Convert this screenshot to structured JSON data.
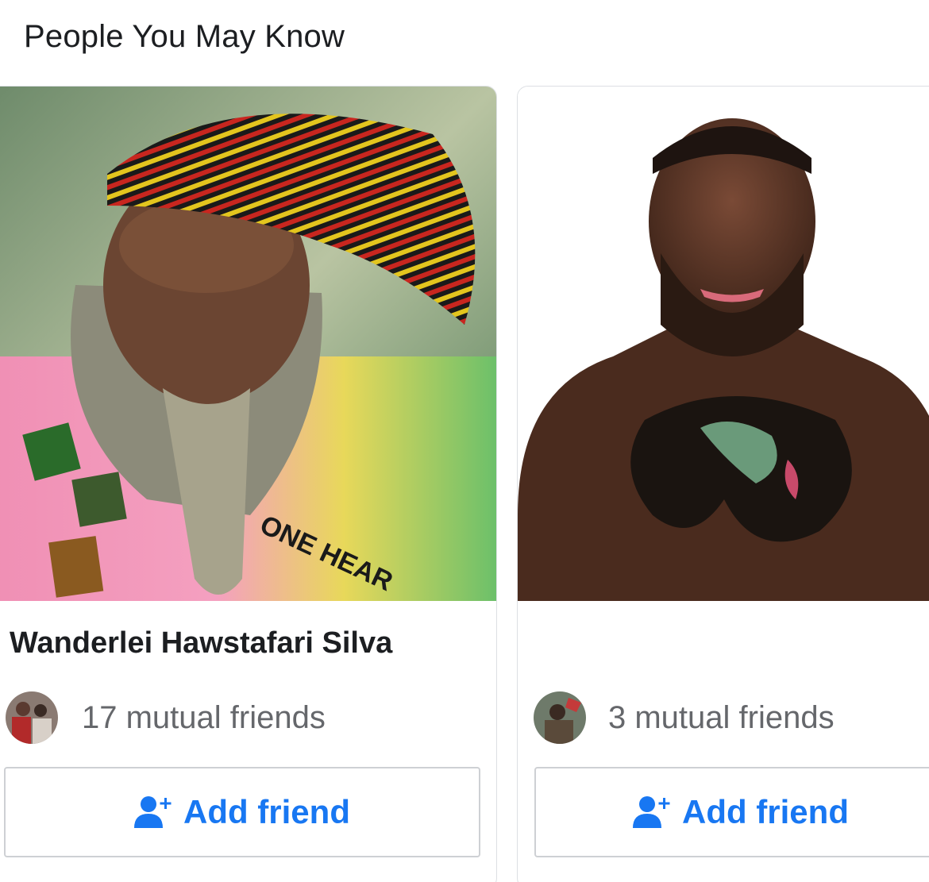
{
  "section": {
    "title": "People You May Know"
  },
  "colors": {
    "accent": "#1877f2",
    "name_text": "#1c1e21",
    "secondary_text": "#65676b",
    "border": "#ced0d4"
  },
  "cards": [
    {
      "name": "Wanderlei Hawstafari Silva",
      "mutual_friends": "17 mutual friends",
      "add_label": "Add friend",
      "icon": "add-friend-icon"
    },
    {
      "name": "",
      "mutual_friends": "3 mutual friends",
      "add_label": "Add friend",
      "icon": "add-friend-icon"
    }
  ]
}
